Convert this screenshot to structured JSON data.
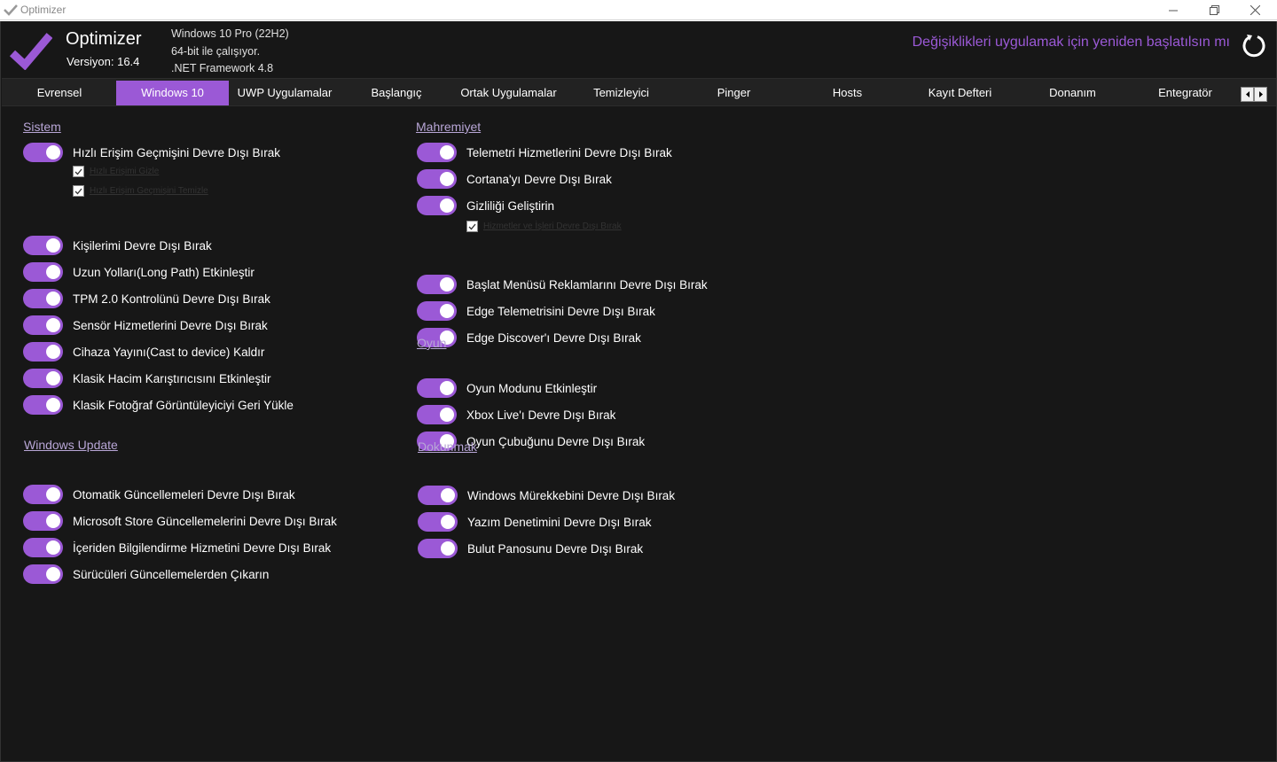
{
  "window": {
    "title": "Optimizer"
  },
  "header": {
    "app_name": "Optimizer",
    "version": "Versiyon: 16.4",
    "os": "Windows 10 Pro (22H2)",
    "arch": "64-bit ile çalışıyor.",
    "framework": ".NET Framework 4.8",
    "restart_prompt": "Değişiklikleri uygulamak için yeniden başlatılsın mı",
    "accent_color": "#9b59d6"
  },
  "tabs": [
    {
      "label": "Evrensel",
      "active": false
    },
    {
      "label": "Windows 10",
      "active": true
    },
    {
      "label": "UWP Uygulamalar",
      "active": false
    },
    {
      "label": "Başlangıç",
      "active": false
    },
    {
      "label": "Ortak Uygulamalar",
      "active": false
    },
    {
      "label": "Temizleyici",
      "active": false
    },
    {
      "label": "Pinger",
      "active": false
    },
    {
      "label": "Hosts",
      "active": false
    },
    {
      "label": "Kayıt Defteri",
      "active": false
    },
    {
      "label": "Donanım",
      "active": false
    },
    {
      "label": "Entegratör",
      "active": false
    }
  ],
  "sections": {
    "sistem": {
      "title": "Sistem",
      "options": [
        {
          "label": "Hızlı Erişim Geçmişini Devre Dışı Bırak",
          "enabled": true
        },
        {
          "label": "Kişilerimi Devre Dışı Bırak",
          "enabled": true
        },
        {
          "label": "Uzun Yolları(Long Path) Etkinleştir",
          "enabled": true
        },
        {
          "label": "TPM 2.0 Kontrolünü Devre Dışı Bırak",
          "enabled": true
        },
        {
          "label": "Sensör Hizmetlerini Devre Dışı Bırak",
          "enabled": true
        },
        {
          "label": "Cihaza Yayını(Cast to device) Kaldır",
          "enabled": true
        },
        {
          "label": "Klasik Hacim Karıştırıcısını Etkinleştir",
          "enabled": true
        },
        {
          "label": "Klasik Fotoğraf Görüntüleyiciyi Geri Yükle",
          "enabled": true
        }
      ],
      "suboptions": [
        {
          "label": "Hızlı Erişimi Gizle",
          "checked": true
        },
        {
          "label": "Hızlı Erişim Geçmişini Temizle",
          "checked": true
        }
      ]
    },
    "windows_update": {
      "title": "Windows Update",
      "options": [
        {
          "label": "Otomatik Güncellemeleri Devre Dışı Bırak",
          "enabled": true
        },
        {
          "label": "Microsoft Store Güncellemelerini Devre Dışı Bırak",
          "enabled": true
        },
        {
          "label": "İçeriden Bilgilendirme Hizmetini Devre Dışı Bırak",
          "enabled": true
        },
        {
          "label": "Sürücüleri Güncellemelerden Çıkarın",
          "enabled": true
        }
      ]
    },
    "mahremiyet": {
      "title": "Mahremiyet",
      "options": [
        {
          "label": "Telemetri Hizmetlerini Devre Dışı Bırak",
          "enabled": true
        },
        {
          "label": "Cortana'yı Devre Dışı Bırak",
          "enabled": true
        },
        {
          "label": "Gizliliği Geliştirin",
          "enabled": true
        },
        {
          "label": "Başlat Menüsü Reklamlarını Devre Dışı Bırak",
          "enabled": true
        },
        {
          "label": "Edge Telemetrisini Devre Dışı Bırak",
          "enabled": true
        },
        {
          "label": "Edge Discover'ı Devre Dışı Bırak",
          "enabled": true
        }
      ],
      "suboptions": [
        {
          "label": "Hizmetler ve İşleri Devre Dışı Bırak",
          "checked": true
        }
      ]
    },
    "oyun": {
      "title": "Oyun",
      "options": [
        {
          "label": "Oyun Modunu Etkinleştir",
          "enabled": true
        },
        {
          "label": "Xbox Live'ı Devre Dışı Bırak",
          "enabled": true
        },
        {
          "label": "Oyun Çubuğunu Devre Dışı Bırak",
          "enabled": true
        }
      ]
    },
    "dokunmak": {
      "title": "Dokunmak",
      "options": [
        {
          "label": "Windows Mürekkebini Devre Dışı Bırak",
          "enabled": true
        },
        {
          "label": "Yazım Denetimini Devre Dışı Bırak",
          "enabled": true
        },
        {
          "label": "Bulut Panosunu Devre Dışı Bırak",
          "enabled": true
        }
      ]
    }
  }
}
